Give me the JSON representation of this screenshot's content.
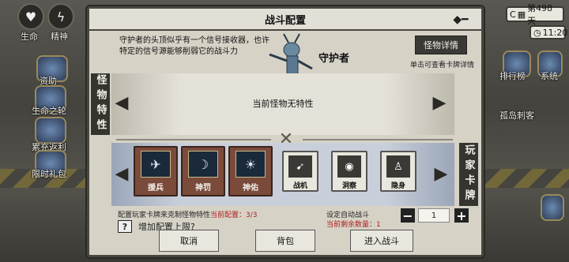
{
  "hud": {
    "left": {
      "life_label": "生命",
      "spirit_label": "精神",
      "items": [
        {
          "label": "资助"
        },
        {
          "label": "生命之轮"
        },
        {
          "label": "累充返利"
        },
        {
          "label": "限时礼包"
        }
      ]
    },
    "right": {
      "day": "第498天",
      "time": "11:20",
      "partial_text": "C",
      "items": [
        {
          "label": "排行榜"
        },
        {
          "label": "系统"
        },
        {
          "label": "孤岛刺客"
        }
      ]
    }
  },
  "dialog": {
    "title": "战斗配置",
    "monster": {
      "description": "守护者的头顶似乎有一个信号接收器，也许特定的信号源能够削弱它的战斗力",
      "name": "守护者",
      "detail_button": "怪物详情",
      "detail_hint": "单击可查看卡牌详情"
    },
    "traits": {
      "section_label": "怪物特性",
      "empty_text": "当前怪物无特性"
    },
    "cards": {
      "section_label": "玩家卡牌",
      "items": [
        {
          "name": "援兵",
          "icon": "airplane-icon",
          "type": "large"
        },
        {
          "name": "神罚",
          "icon": "scythe-icon",
          "type": "large"
        },
        {
          "name": "神佑",
          "icon": "radiant-cup-icon",
          "type": "large"
        },
        {
          "name": "战机",
          "icon": "fighter-jet-icon",
          "type": "small"
        },
        {
          "name": "洞察",
          "icon": "eye-icon",
          "type": "small"
        },
        {
          "name": "隐身",
          "icon": "figure-icon",
          "type": "small"
        }
      ]
    },
    "config": {
      "counter_prefix": "配置玩家卡牌来克制怪物特性",
      "counter_label": "当前配置：",
      "counter_value": "3/3",
      "increase_label": "增加配置上限?",
      "question": "?",
      "auto_label": "设定自动战斗",
      "remaining_label": "当前剩余数量：",
      "remaining_value": "1",
      "stepper_value": "1"
    },
    "actions": {
      "cancel": "取消",
      "backpack": "背包",
      "enter_battle": "进入战斗"
    }
  }
}
